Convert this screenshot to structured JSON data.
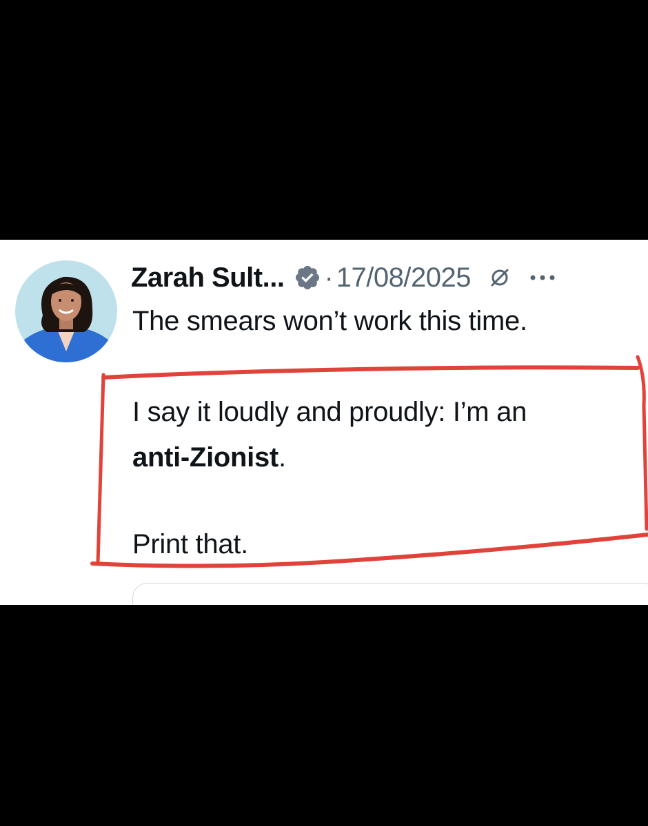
{
  "post": {
    "author_name": "Zarah Sult...",
    "separator": "·",
    "date": "17/08/2025",
    "line1": "The smears won’t work this time.",
    "line2": "I say it loudly and proudly: I’m an",
    "line3_bold": "anti-Zionist",
    "line3_rest": ".",
    "line4": "Print that."
  },
  "icons": {
    "verified": "verified-badge-icon",
    "edited": "edit-history-icon",
    "more": "more-options-icon"
  },
  "colors": {
    "background": "#000000",
    "card": "#ffffff",
    "text_primary": "#0f1419",
    "text_secondary": "#536471",
    "highlight": "#e0433a",
    "badge": "#6b7785"
  }
}
